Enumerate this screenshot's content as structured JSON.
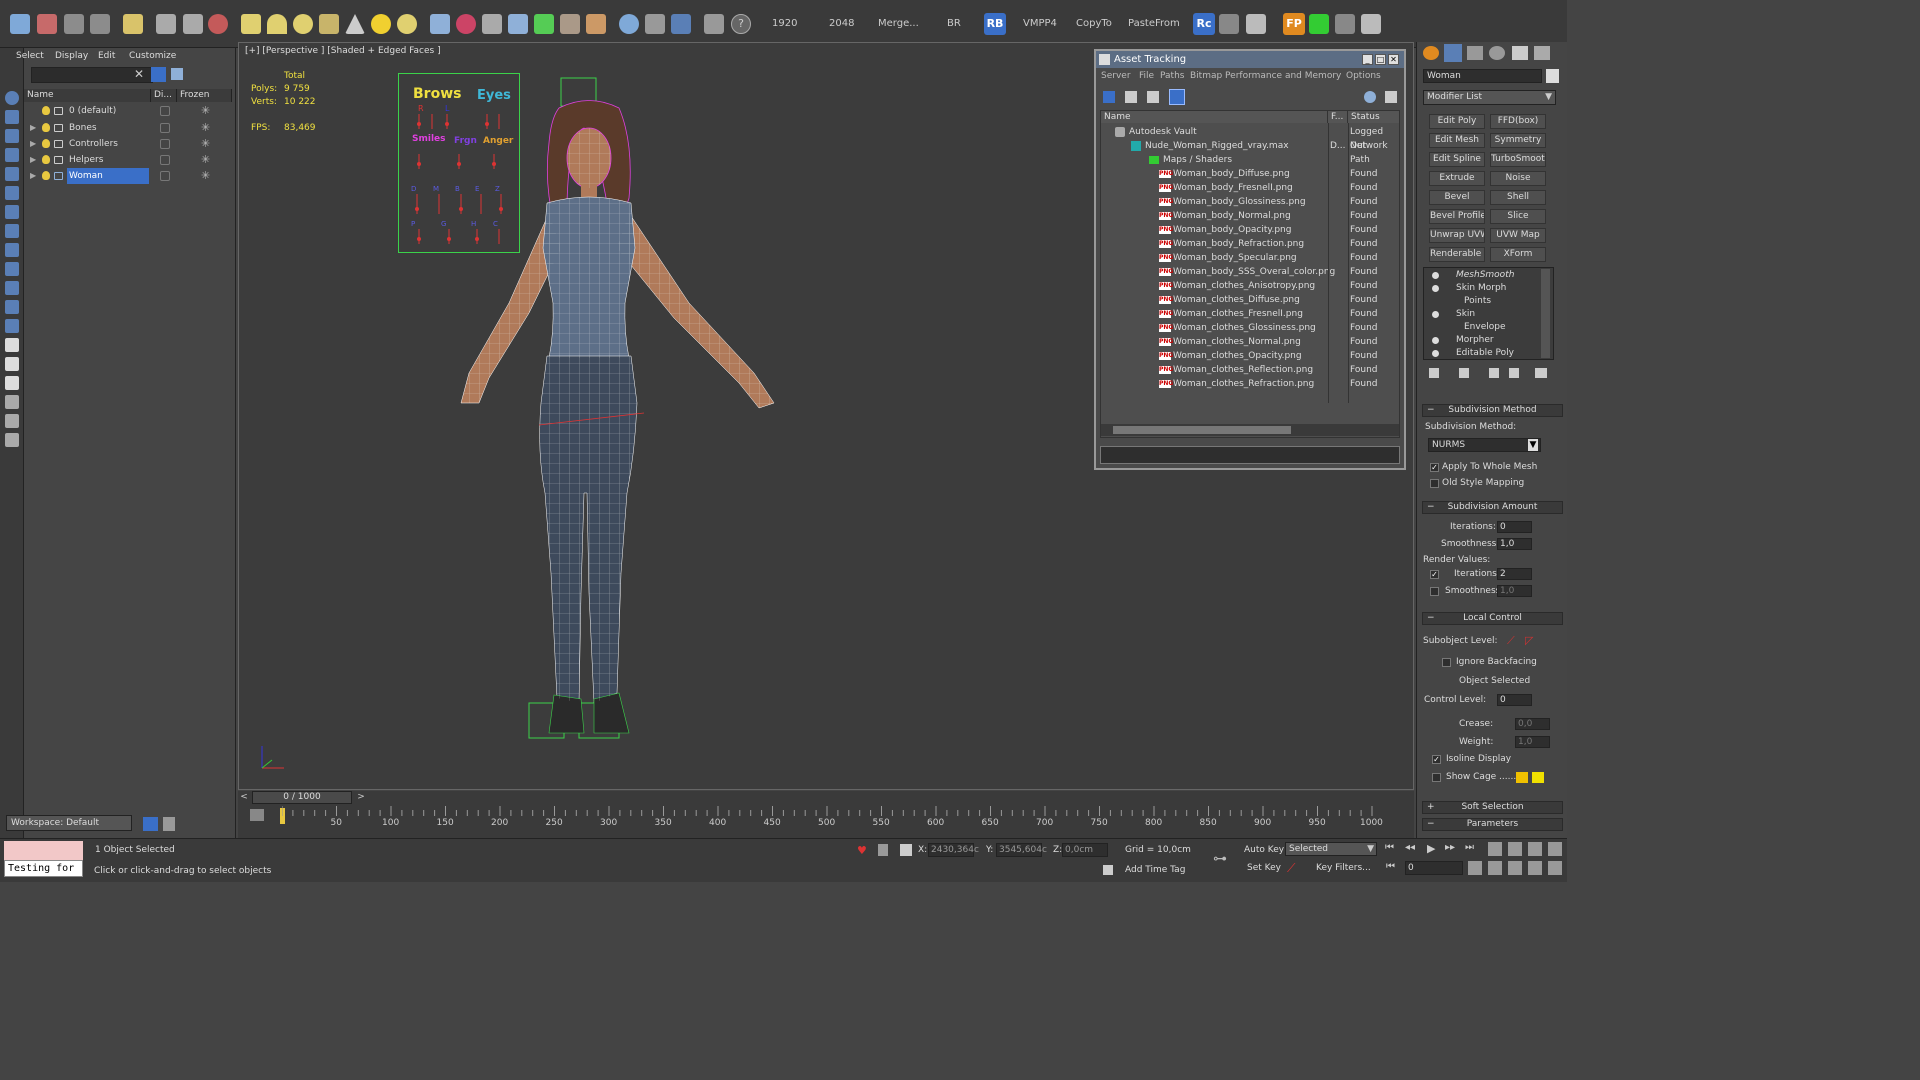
{
  "toolbar": {
    "numbers": [
      "1920",
      "2048"
    ],
    "buttons": [
      "Merge...",
      "BR",
      "VMPP4",
      "CopyTo",
      "PasteFrom"
    ],
    "badges": [
      "RB",
      "Rc",
      "FP"
    ]
  },
  "explorer": {
    "menu": [
      "Select",
      "Display",
      "Edit",
      "Customize"
    ],
    "columns": [
      "Name",
      "Di...",
      "Frozen"
    ],
    "rows": [
      {
        "label": "0 (default)"
      },
      {
        "label": "Bones"
      },
      {
        "label": "Controllers"
      },
      {
        "label": "Helpers"
      },
      {
        "label": "Woman",
        "selected": true
      }
    ],
    "workspace": "Workspace: Default"
  },
  "viewport": {
    "label": "[+] [Perspective ] [Shaded + Edged Faces ]",
    "stats": {
      "total_label": "Total",
      "polys_label": "Polys:",
      "polys": "9 759",
      "verts_label": "Verts:",
      "verts": "10 222",
      "fps_label": "FPS:",
      "fps": "83,469"
    },
    "face_panel": {
      "brows": "Brows",
      "eyes": "Eyes",
      "r": "R",
      "l": "L",
      "smiles": "Smiles",
      "frown": "Frgn",
      "anger": "Anger"
    }
  },
  "asset_tracking": {
    "title": "Asset Tracking",
    "menu": [
      "Server",
      "File",
      "Paths",
      "Bitmap Performance and Memory",
      "Options"
    ],
    "columns": [
      "Name",
      "F...",
      "Status"
    ],
    "rows": [
      {
        "name": "Autodesk Vault",
        "f": "",
        "status": "Logged Out",
        "indent": 0,
        "type": "vault"
      },
      {
        "name": "Nude_Woman_Rigged_vray.max",
        "f": "D...",
        "status": "Network Path",
        "indent": 1,
        "type": "max"
      },
      {
        "name": "Maps / Shaders",
        "f": "",
        "status": "",
        "indent": 2,
        "type": "folder"
      },
      {
        "name": "Woman_body_Diffuse.png",
        "f": "",
        "status": "Found",
        "indent": 3,
        "type": "png"
      },
      {
        "name": "Woman_body_FresnelI.png",
        "f": "",
        "status": "Found",
        "indent": 3,
        "type": "png"
      },
      {
        "name": "Woman_body_Glossiness.png",
        "f": "",
        "status": "Found",
        "indent": 3,
        "type": "png"
      },
      {
        "name": "Woman_body_Normal.png",
        "f": "",
        "status": "Found",
        "indent": 3,
        "type": "png"
      },
      {
        "name": "Woman_body_Opacity.png",
        "f": "",
        "status": "Found",
        "indent": 3,
        "type": "png"
      },
      {
        "name": "Woman_body_Refraction.png",
        "f": "",
        "status": "Found",
        "indent": 3,
        "type": "png"
      },
      {
        "name": "Woman_body_Specular.png",
        "f": "",
        "status": "Found",
        "indent": 3,
        "type": "png"
      },
      {
        "name": "Woman_body_SSS_Overal_color.png",
        "f": "",
        "status": "Found",
        "indent": 3,
        "type": "png"
      },
      {
        "name": "Woman_clothes_Anisotropy.png",
        "f": "",
        "status": "Found",
        "indent": 3,
        "type": "png"
      },
      {
        "name": "Woman_clothes_Diffuse.png",
        "f": "",
        "status": "Found",
        "indent": 3,
        "type": "png"
      },
      {
        "name": "Woman_clothes_FresnelI.png",
        "f": "",
        "status": "Found",
        "indent": 3,
        "type": "png"
      },
      {
        "name": "Woman_clothes_Glossiness.png",
        "f": "",
        "status": "Found",
        "indent": 3,
        "type": "png"
      },
      {
        "name": "Woman_clothes_Normal.png",
        "f": "",
        "status": "Found",
        "indent": 3,
        "type": "png"
      },
      {
        "name": "Woman_clothes_Opacity.png",
        "f": "",
        "status": "Found",
        "indent": 3,
        "type": "png"
      },
      {
        "name": "Woman_clothes_Reflection.png",
        "f": "",
        "status": "Found",
        "indent": 3,
        "type": "png"
      },
      {
        "name": "Woman_clothes_Refraction.png",
        "f": "",
        "status": "Found",
        "indent": 3,
        "type": "png"
      }
    ]
  },
  "command_panel": {
    "object_name": "Woman",
    "modifier_list": "Modifier List",
    "modifier_buttons": [
      "Edit Poly",
      "FFD(box)",
      "Edit Mesh",
      "Symmetry",
      "Edit Spline",
      "TurboSmooth",
      "Extrude",
      "Noise",
      "Bevel",
      "Shell",
      "Bevel Profile",
      "Slice",
      "Unwrap UVW",
      "UVW Map",
      "Renderable Spline",
      "XForm"
    ],
    "stack": [
      "MeshSmooth",
      "Skin Morph",
      "Points",
      "Skin",
      "Envelope",
      "Morpher",
      "Editable Poly"
    ],
    "subdivision_method_rollout": "Subdivision Method",
    "subdivision_method_label": "Subdivision Method:",
    "subdivision_method_value": "NURMS",
    "apply_whole_mesh": "Apply To Whole Mesh",
    "old_style_mapping": "Old Style Mapping",
    "subdivision_amount_rollout": "Subdivision Amount",
    "iterations_label": "Iterations:",
    "iterations": "0",
    "smoothness_label": "Smoothness:",
    "smoothness": "1,0",
    "render_values_label": "Render Values:",
    "render_iterations": "2",
    "render_smoothness": "1,0",
    "local_control_rollout": "Local Control",
    "subobject_level_label": "Subobject Level:",
    "ignore_backfacing": "Ignore Backfacing",
    "object_selected": "Object Selected",
    "control_level_label": "Control Level:",
    "control_level": "0",
    "crease_label": "Crease:",
    "crease": "0,0",
    "weight_label": "Weight:",
    "weight": "1,0",
    "isoline_display": "Isoline Display",
    "show_cage": "Show Cage ......",
    "soft_selection_rollout": "Soft Selection",
    "parameters_rollout": "Parameters"
  },
  "timeline": {
    "frame_display": "0 / 1000",
    "ticks": [
      "50",
      "100",
      "150",
      "200",
      "250",
      "300",
      "350",
      "400",
      "450",
      "500",
      "550",
      "600",
      "650",
      "700",
      "750",
      "800",
      "850",
      "900",
      "950",
      "1000"
    ]
  },
  "statusbar": {
    "script_listener": "Testing for",
    "selection": "1 Object Selected",
    "prompt": "Click or click-and-drag to select objects",
    "x_label": "X:",
    "x_value": "2430,364c",
    "y_label": "Y:",
    "y_value": "3545,604c",
    "z_label": "Z:",
    "z_value": "0,0cm",
    "grid": "Grid = 10,0cm",
    "auto_key": "Auto Key",
    "selected_dropdown": "Selected",
    "set_key": "Set Key",
    "key_filters": "Key Filters...",
    "add_time_tag": "Add Time Tag",
    "frame": "0"
  },
  "colors": {
    "selection_blue": "#3a6fc8",
    "wire_white": "#ffffff",
    "skin": "#b07a5a",
    "cloth": "#5d6f88",
    "bone_green": "#3bd24a",
    "face_panel_green": "#3bd24a",
    "vault_yellow": "#f0e040"
  }
}
